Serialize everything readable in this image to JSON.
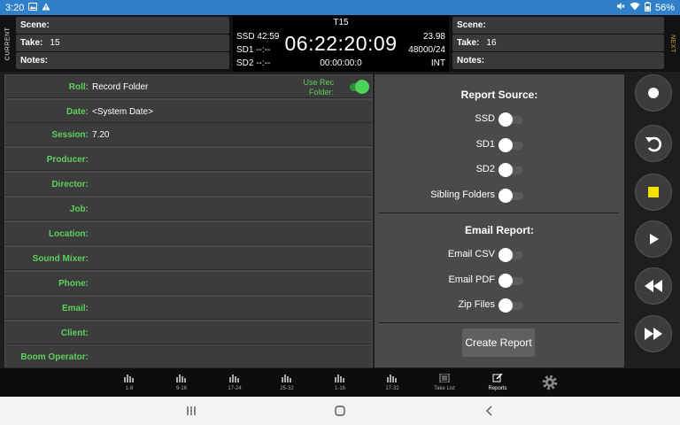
{
  "status_bar": {
    "time": "3:20",
    "battery": "56%"
  },
  "header": {
    "current_label": "CURRENT",
    "next_label": "NEXT",
    "current": {
      "scene_label": "Scene:",
      "scene_value": "",
      "take_label": "Take:",
      "take_value": "15",
      "notes_label": "Notes:",
      "notes_value": ""
    },
    "next": {
      "scene_label": "Scene:",
      "scene_value": "",
      "take_label": "Take:",
      "take_value": "16",
      "notes_label": "Notes:",
      "notes_value": ""
    },
    "timecode": {
      "take_name": "T15",
      "ssd": "SSD 42:59",
      "sd1": "SD1 --:--",
      "sd2": "SD2 --:--",
      "main": "06:22:20:09",
      "elapsed": "00:00:00:0",
      "fps": "23.98",
      "rate": "48000/24",
      "mode": "INT"
    }
  },
  "form": {
    "use_rec_folder_label": "Use Rec Folder:",
    "use_rec_folder_on": true,
    "fields": [
      {
        "label": "Roll:",
        "value": "Record Folder"
      },
      {
        "label": "Date:",
        "value": "<System Date>"
      },
      {
        "label": "Session:",
        "value": "7.20"
      },
      {
        "label": "Producer:",
        "value": ""
      },
      {
        "label": "Director:",
        "value": ""
      },
      {
        "label": "Job:",
        "value": ""
      },
      {
        "label": "Location:",
        "value": ""
      },
      {
        "label": "Sound Mixer:",
        "value": ""
      },
      {
        "label": "Phone:",
        "value": ""
      },
      {
        "label": "Email:",
        "value": ""
      },
      {
        "label": "Client:",
        "value": ""
      },
      {
        "label": "Boom Operator:",
        "value": ""
      }
    ]
  },
  "report": {
    "source_title": "Report Source:",
    "sources": [
      {
        "label": "SSD",
        "on": false
      },
      {
        "label": "SD1",
        "on": false
      },
      {
        "label": "SD2",
        "on": false
      },
      {
        "label": "Sibling Folders",
        "on": false
      }
    ],
    "email_title": "Email Report:",
    "emails": [
      {
        "label": "Email CSV",
        "on": false
      },
      {
        "label": "Email PDF",
        "on": false
      },
      {
        "label": "Zip Files",
        "on": false
      }
    ],
    "create_button": "Create Report"
  },
  "transport": {
    "buttons": [
      "record-icon",
      "undo-icon",
      "stop-icon",
      "play-icon",
      "rewind-icon",
      "fast-forward-icon"
    ],
    "stop_color": "#f5e000"
  },
  "tabs": [
    {
      "label": "1-8"
    },
    {
      "label": "9-16"
    },
    {
      "label": "17-24"
    },
    {
      "label": "25-32"
    },
    {
      "label": "1-16"
    },
    {
      "label": "17-32"
    },
    {
      "label": "Take List"
    },
    {
      "label": "Reports"
    }
  ],
  "colors": {
    "status_bar": "#2f80c8",
    "label_green": "#5dd15d",
    "next_orange": "#e0a030"
  }
}
